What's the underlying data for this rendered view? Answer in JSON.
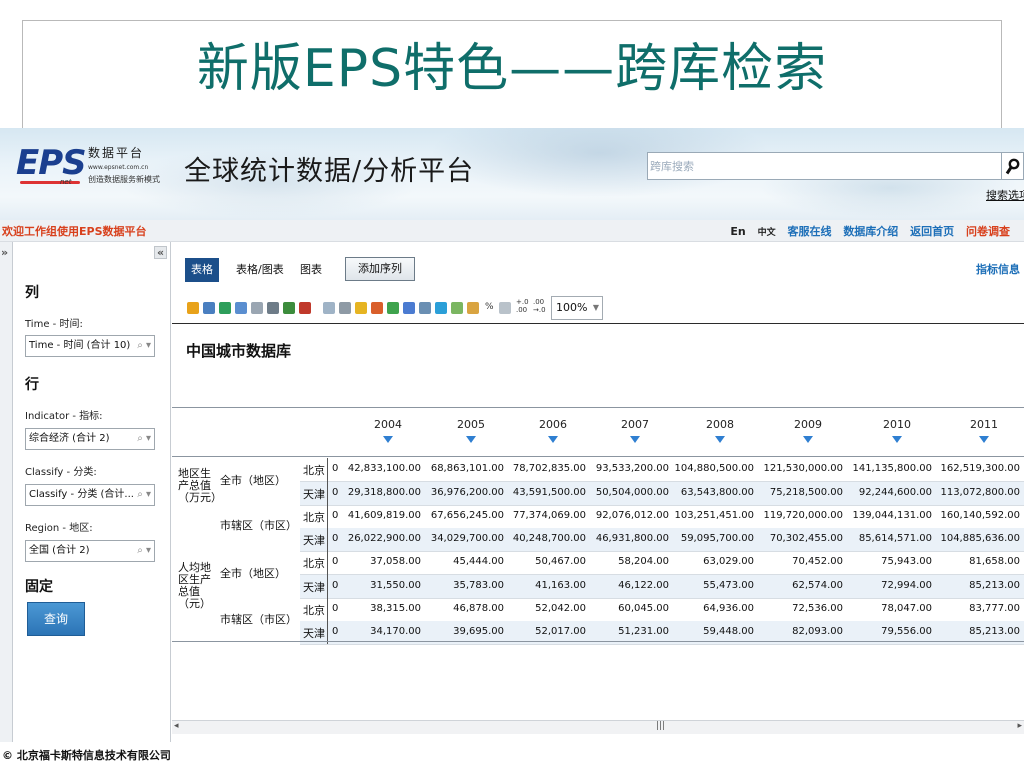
{
  "slide": {
    "title": "新版EPS特色——跨库检索"
  },
  "header": {
    "logo_text": "EPS",
    "logo_sub": "net",
    "logo_cn": "数据平台",
    "logo_url": "www.epsnet.com.cn",
    "logo_slogan": "创造数据服务新模式",
    "platform_title": "全球统计数据/分析平台",
    "search_placeholder": "跨库搜索",
    "search_options": "搜索选项"
  },
  "nav": {
    "welcome": "欢迎工作组使用EPS数据平台",
    "en": "En",
    "cn": "中文",
    "links": [
      "客服在线",
      "数据库介绍",
      "返回首页"
    ],
    "survey": "问卷调查"
  },
  "left_panel": {
    "col_heading": "列",
    "time_label": "Time - 时间:",
    "time_value": "Time - 时间 (合计 10)",
    "row_heading": "行",
    "indicator_label": "Indicator - 指标:",
    "indicator_value": "综合经济 (合计 2)",
    "classify_label": "Classify - 分类:",
    "classify_value": "Classify - 分类 (合计...",
    "region_label": "Region - 地区:",
    "region_value": "全国 (合计 2)",
    "fixed_heading": "固定",
    "query_button": "查询"
  },
  "main": {
    "tabs": [
      "表格",
      "表格/图表",
      "图表"
    ],
    "add_series": "添加序列",
    "indicator_info": "指标信息",
    "zoom": "100%",
    "percent_glyph": "%",
    "db_title": "中国城市数据库"
  },
  "table": {
    "years": [
      "2004",
      "2005",
      "2006",
      "2007",
      "2008",
      "2009",
      "2010",
      "2011"
    ],
    "groups": [
      {
        "name": "地区生产总值（万元）",
        "subs": [
          "全市（地区）",
          "市辖区（市区）"
        ]
      },
      {
        "name": "人均地区生产总值（元）",
        "subs": [
          "全市（地区）",
          "市辖区（市区）"
        ]
      }
    ],
    "rows": [
      {
        "city": "北京",
        "flag": "0",
        "values": [
          "42,833,100.00",
          "68,863,101.00",
          "78,702,835.00",
          "93,533,200.00",
          "104,880,500.00",
          "121,530,000.00",
          "141,135,800.00",
          "162,519,300.00"
        ]
      },
      {
        "city": "天津",
        "flag": "0",
        "values": [
          "29,318,800.00",
          "36,976,200.00",
          "43,591,500.00",
          "50,504,000.00",
          "63,543,800.00",
          "75,218,500.00",
          "92,244,600.00",
          "113,072,800.00"
        ]
      },
      {
        "city": "北京",
        "flag": "0",
        "values": [
          "41,609,819.00",
          "67,656,245.00",
          "77,374,069.00",
          "92,076,012.00",
          "103,251,451.00",
          "119,720,000.00",
          "139,044,131.00",
          "160,140,592.00"
        ]
      },
      {
        "city": "天津",
        "flag": "0",
        "values": [
          "26,022,900.00",
          "34,029,700.00",
          "40,248,700.00",
          "46,931,800.00",
          "59,095,700.00",
          "70,302,455.00",
          "85,614,571.00",
          "104,885,636.00"
        ]
      },
      {
        "city": "北京",
        "flag": "0",
        "values": [
          "37,058.00",
          "45,444.00",
          "50,467.00",
          "58,204.00",
          "63,029.00",
          "70,452.00",
          "75,943.00",
          "81,658.00"
        ]
      },
      {
        "city": "天津",
        "flag": "0",
        "values": [
          "31,550.00",
          "35,783.00",
          "41,163.00",
          "46,122.00",
          "55,473.00",
          "62,574.00",
          "72,994.00",
          "85,213.00"
        ]
      },
      {
        "city": "北京",
        "flag": "0",
        "values": [
          "38,315.00",
          "46,878.00",
          "52,042.00",
          "60,045.00",
          "64,936.00",
          "72,536.00",
          "78,047.00",
          "83,777.00"
        ]
      },
      {
        "city": "天津",
        "flag": "0",
        "values": [
          "34,170.00",
          "39,695.00",
          "52,017.00",
          "51,231.00",
          "59,448.00",
          "82,093.00",
          "79,556.00",
          "85,213.00"
        ]
      }
    ]
  },
  "footer": {
    "copyright": "© 北京福卡斯特信息技术有限公司"
  },
  "colors": {
    "title": "#0f6e6a",
    "nav_accent": "#d8401c",
    "link_blue": "#1d6fb8",
    "tab_active": "#1c4f8a"
  }
}
